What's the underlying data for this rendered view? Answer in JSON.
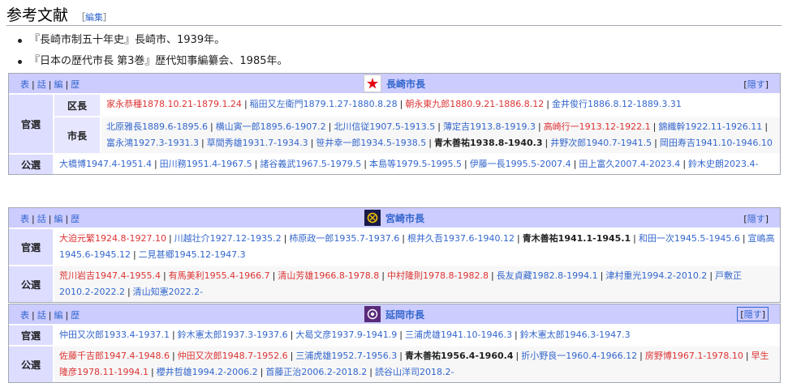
{
  "section": {
    "title": "参考文献",
    "edit_open": "［",
    "edit_label": "編集",
    "edit_close": "］"
  },
  "references": [
    "『長崎市制五十年史』長崎市、1939年。",
    "『日本の歴代市長 第3巻』歴代知事編纂会、1985年。"
  ],
  "navboxes": [
    {
      "title": "長崎市長",
      "vde": [
        "表",
        "話",
        "編",
        "歴"
      ],
      "hide_label": "隠す",
      "emblem_icon": "nagasaki-emblem-icon",
      "emblem_color": "#e60012",
      "groups": {
        "kansen": "官選",
        "kucho": "区長",
        "shicho": "市長",
        "kosen": "公選"
      },
      "kucho_list": [
        {
          "t": "家永恭種1878.10.21-1879.1.24",
          "c": "red"
        },
        {
          "t": "稲田又左衛門1879.1.27-1880.8.28",
          "c": "blue"
        },
        {
          "t": "朝永東九郎1880.9.21-1886.8.12",
          "c": "red"
        },
        {
          "t": "金井俊行1886.8.12-1889.3.31",
          "c": "blue"
        }
      ],
      "shicho_list": [
        {
          "t": "北原雅長1889.6-1895.6",
          "c": "blue"
        },
        {
          "t": "横山寅一郎1895.6-1907.2",
          "c": "blue"
        },
        {
          "t": "北川信従1907.5-1913.5",
          "c": "blue"
        },
        {
          "t": "薄定吉1913.8-1919.3",
          "c": "blue"
        },
        {
          "t": "高崎行一1913.12-1922.1",
          "c": "red"
        },
        {
          "t": "錦織幹1922.11-1926.11",
          "c": "blue"
        },
        {
          "t": "富永鴻1927.3-1931.3",
          "c": "blue"
        },
        {
          "t": "草間秀雄1931.7-1934.3",
          "c": "blue"
        },
        {
          "t": "笹井幸一郎1934.5-1938.5",
          "c": "blue"
        },
        {
          "t": "青木善祐1938.8-1940.3",
          "c": "bold"
        },
        {
          "t": "井野次郎1940.7-1941.5",
          "c": "blue"
        },
        {
          "t": "岡田寿吉1941.10-1946.10",
          "c": "blue"
        }
      ],
      "kosen_list": [
        {
          "t": "大橋博1947.4-1951.4",
          "c": "blue"
        },
        {
          "t": "田川務1951.4-1967.5",
          "c": "blue"
        },
        {
          "t": "諸谷義武1967.5-1979.5",
          "c": "blue"
        },
        {
          "t": "本島等1979.5-1995.5",
          "c": "blue"
        },
        {
          "t": "伊藤一長1995.5-2007.4",
          "c": "blue"
        },
        {
          "t": "田上富久2007.4-2023.4",
          "c": "blue"
        },
        {
          "t": "鈴木史朗2023.4-",
          "c": "blue"
        }
      ]
    },
    {
      "title": "宮崎市長",
      "vde": [
        "表",
        "話",
        "編",
        "歴"
      ],
      "hide_label": "隠す",
      "emblem_icon": "miyazaki-emblem-icon",
      "emblem_color": "#1a1a4a",
      "groups": {
        "kansen": "官選",
        "kosen": "公選"
      },
      "kansen_list": [
        {
          "t": "大迫元繁1924.8-1927.10",
          "c": "red"
        },
        {
          "t": "川越壮介1927.12-1935.2",
          "c": "blue"
        },
        {
          "t": "柿原政一郎1935.7-1937.6",
          "c": "blue"
        },
        {
          "t": "根井久吾1937.6-1940.12",
          "c": "blue"
        },
        {
          "t": "青木善祐1941.1-1945.1",
          "c": "bold"
        },
        {
          "t": "和田一次1945.5-1945.6",
          "c": "blue"
        },
        {
          "t": "宣嶋高1945.6-1945.12",
          "c": "blue"
        },
        {
          "t": "二見甚郷1945.12-1947.3",
          "c": "blue"
        }
      ],
      "kosen_list": [
        {
          "t": "荒川岩吉1947.4-1955.4",
          "c": "red"
        },
        {
          "t": "有馬美利1955.4-1966.7",
          "c": "red"
        },
        {
          "t": "清山芳雄1966.8-1978.8",
          "c": "red"
        },
        {
          "t": "中村隆則1978.8-1982.8",
          "c": "red"
        },
        {
          "t": "長友貞藏1982.8-1994.1",
          "c": "blue"
        },
        {
          "t": "津村重光1994.2-2010.2",
          "c": "blue"
        },
        {
          "t": "戸敷正2010.2-2022.2",
          "c": "blue"
        },
        {
          "t": "清山知憲2022.2-",
          "c": "blue"
        }
      ]
    },
    {
      "title": "延岡市長",
      "vde": [
        "表",
        "話",
        "編",
        "歴"
      ],
      "hide_label": "隠す",
      "emblem_icon": "nobeoka-emblem-icon",
      "emblem_color": "#5a2a7a",
      "groups": {
        "kansen": "官選",
        "kosen": "公選"
      },
      "kansen_list": [
        {
          "t": "仲田又次郎1933.4-1937.1",
          "c": "blue"
        },
        {
          "t": "鈴木憲太郎1937.3-1937.6",
          "c": "blue"
        },
        {
          "t": "大曷文彦1937.9-1941.9",
          "c": "blue"
        },
        {
          "t": "三浦虎雄1941.10-1946.3",
          "c": "blue"
        },
        {
          "t": "鈴木憲太郎1946.3-1947.3",
          "c": "blue"
        }
      ],
      "kosen_list": [
        {
          "t": "佐藤千吉郎1947.4-1948.6",
          "c": "red"
        },
        {
          "t": "仲田又次郎1948.7-1952.6",
          "c": "red"
        },
        {
          "t": "三浦虎雄1952.7-1956.3",
          "c": "blue"
        },
        {
          "t": "青木善祐1956.4-1960.4",
          "c": "bold"
        },
        {
          "t": "折小野良一1960.4-1966.12",
          "c": "blue"
        },
        {
          "t": "房野博1967.1-1978.10",
          "c": "red"
        },
        {
          "t": "早生隆彦1978.11-1994.1",
          "c": "red"
        },
        {
          "t": "櫻井哲雄1994.2-2006.2",
          "c": "blue"
        },
        {
          "t": "首藤正治2006.2-2018.2",
          "c": "blue"
        },
        {
          "t": "読谷山洋司2018.2-",
          "c": "blue"
        }
      ]
    }
  ],
  "colors": {
    "title_bar": "#ccccff",
    "group_cell": "#ddddff",
    "link": "#3366cc",
    "redlink": "#dd3333"
  }
}
